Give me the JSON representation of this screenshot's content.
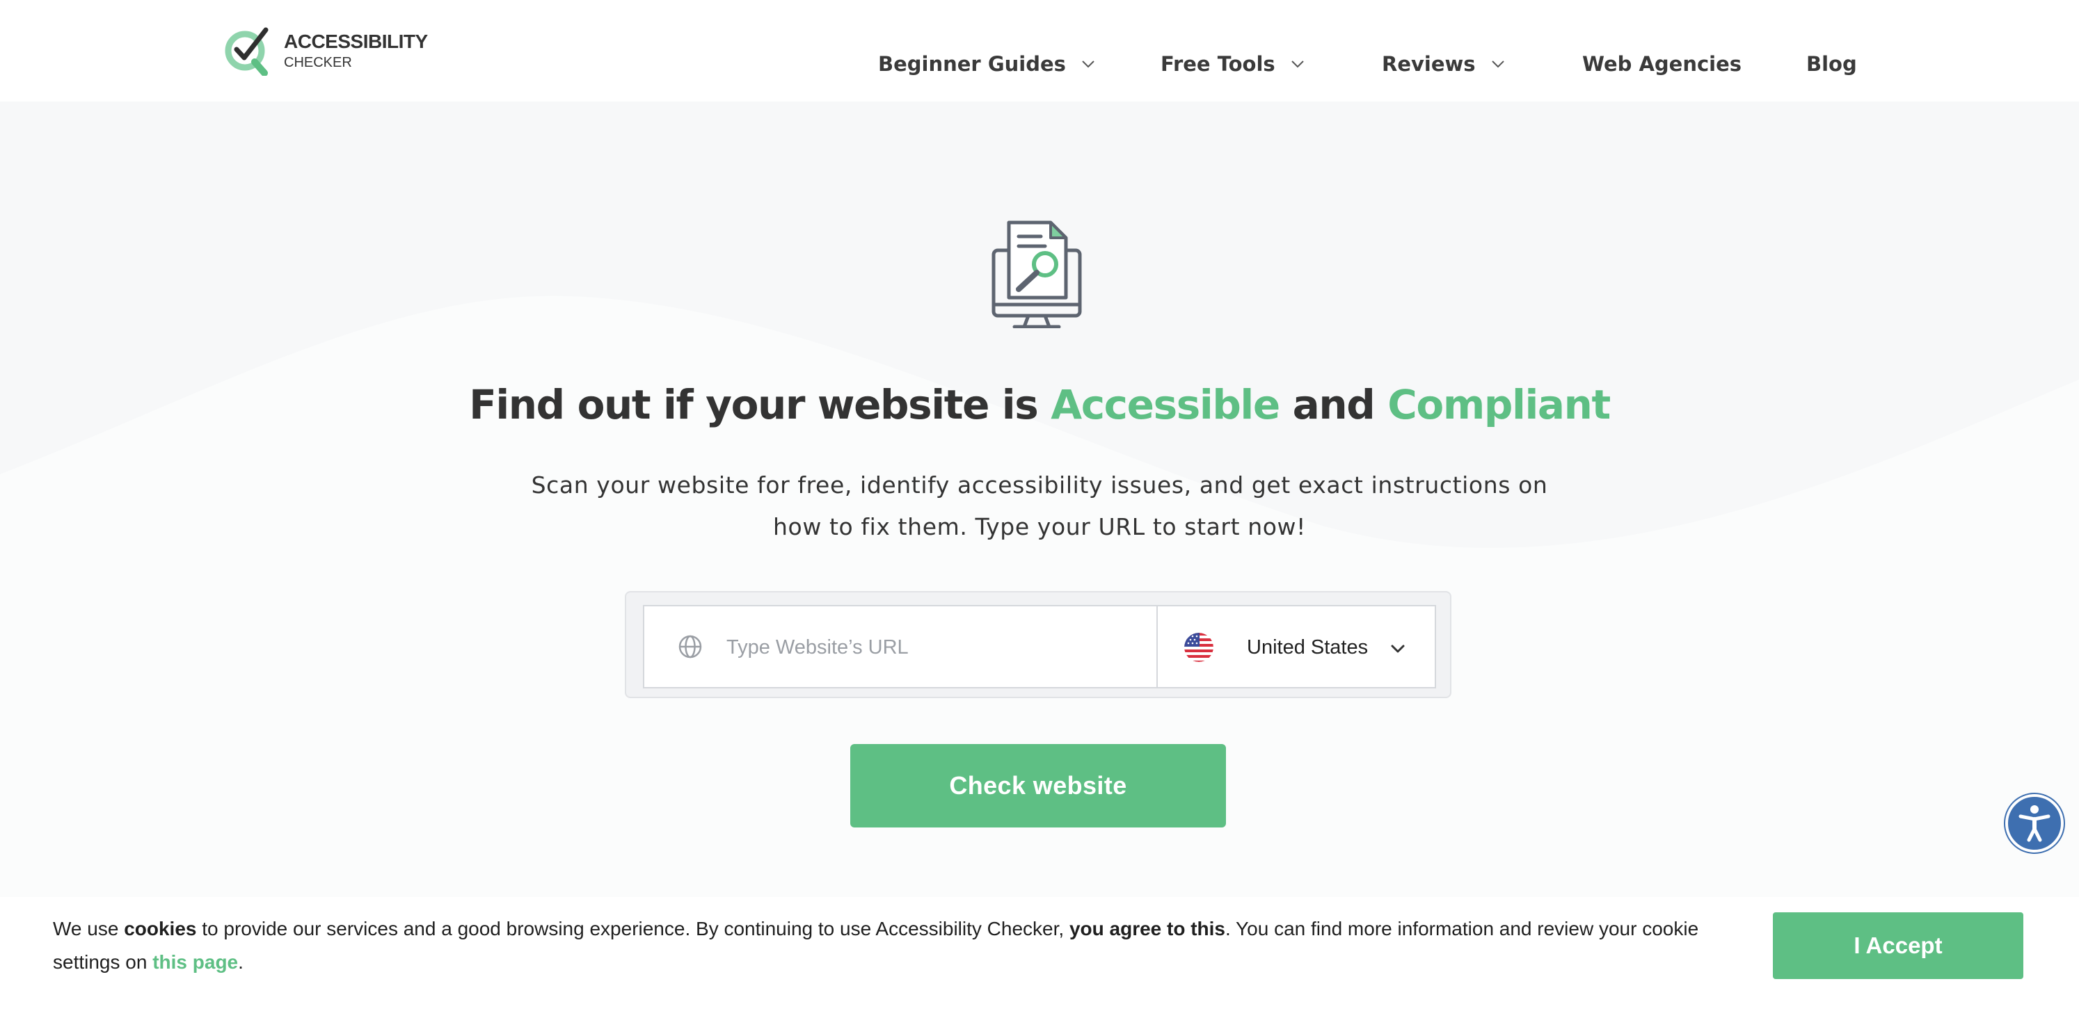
{
  "logo": {
    "line1": "ACCESSIBILITY",
    "line2": "CHECKER"
  },
  "nav": {
    "items": [
      {
        "label": "Beginner Guides",
        "has_dropdown": true
      },
      {
        "label": "Free Tools",
        "has_dropdown": true
      },
      {
        "label": "Reviews",
        "has_dropdown": true
      },
      {
        "label": "Web Agencies",
        "has_dropdown": false
      },
      {
        "label": "Blog",
        "has_dropdown": false
      }
    ]
  },
  "hero": {
    "icon": "monitor-document-search-icon",
    "headline": {
      "part1": "Find out if your website is ",
      "highlight1": "Accessible",
      "part2": " and ",
      "highlight2": "Compliant"
    },
    "subtitle_line1": "Scan your website for free, identify accessibility issues, and get exact instructions on",
    "subtitle_line2": "how to fix them. Type your URL to start now!",
    "url_placeholder": "Type Website’s URL",
    "url_value": "",
    "country": {
      "selected": "United States",
      "flag": "us-flag-icon"
    },
    "button_label": "Check website"
  },
  "accessibility_widget": {
    "icon": "accessibility-person-icon"
  },
  "cookie_bar": {
    "t1": "We use ",
    "b1": "cookies",
    "t2": " to provide our services and a good browsing experience. By continuing to use Accessibility Checker, ",
    "b2": "you agree to this",
    "t3": ". You can find more information and review your cookie settings on ",
    "link": "this page",
    "t4": ".",
    "accept_label": "I Accept"
  },
  "colors": {
    "accent_green": "#5ebf84",
    "text_dark": "#333333",
    "widget_blue": "#3e6fb0",
    "hero_bg": "#f8f9fa"
  }
}
